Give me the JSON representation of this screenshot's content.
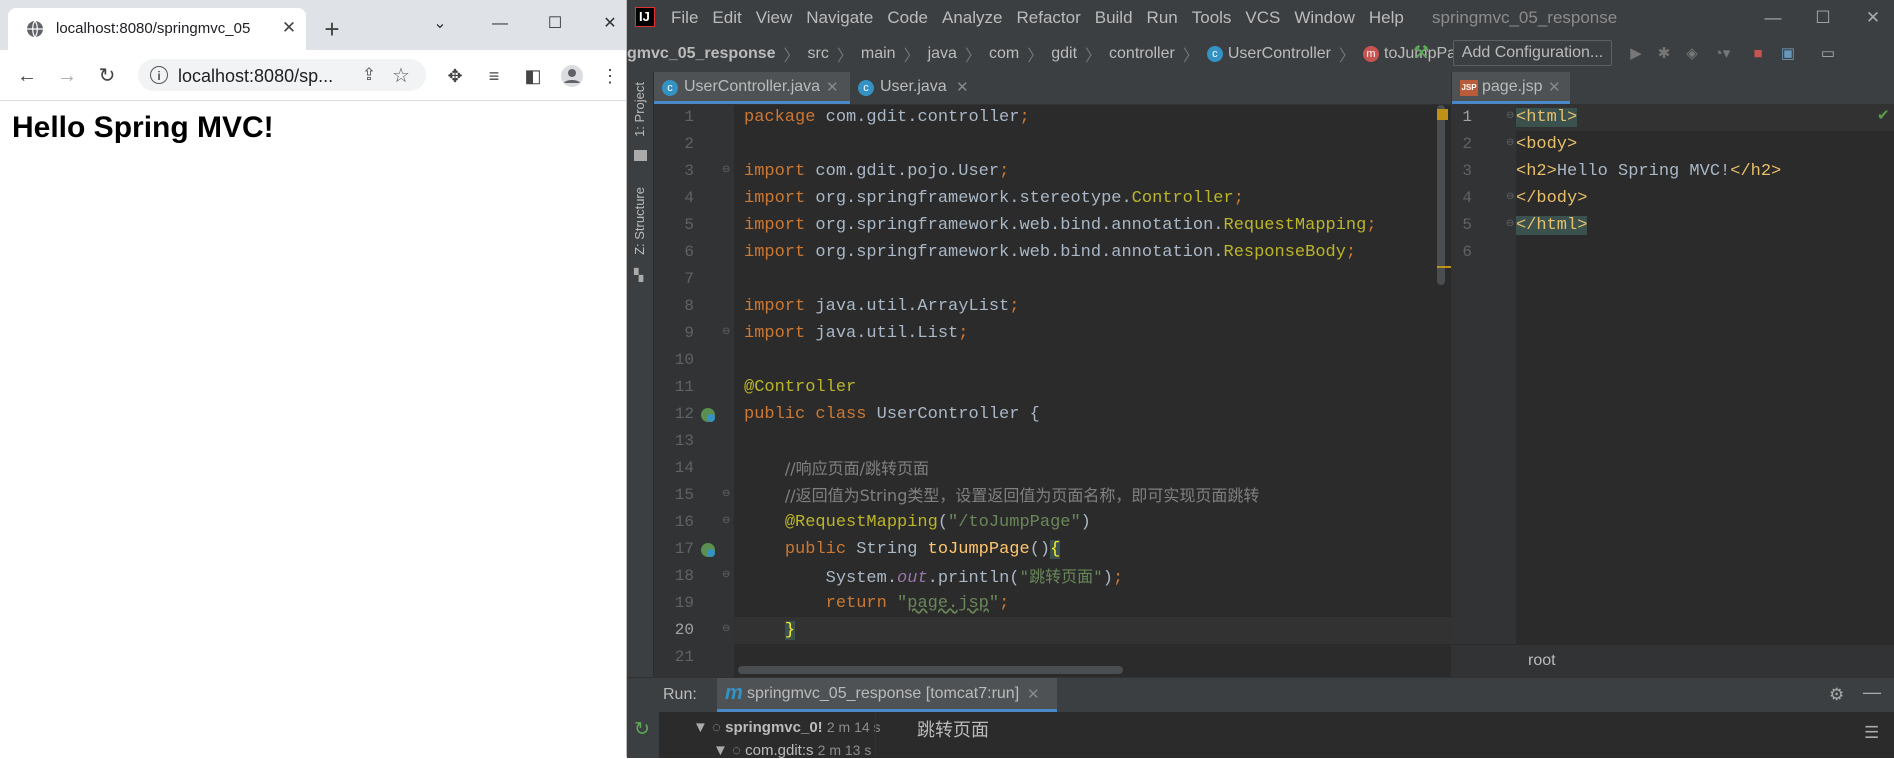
{
  "browser": {
    "tab_title": "localhost:8080/springmvc_05",
    "tab_close": "✕",
    "new_tab": "+",
    "url": "localhost:8080/sp...",
    "page_heading": "Hello Spring MVC!"
  },
  "ide": {
    "menu": [
      "File",
      "Edit",
      "View",
      "Navigate",
      "Code",
      "Analyze",
      "Refactor",
      "Build",
      "Run",
      "Tools",
      "VCS",
      "Window",
      "Help"
    ],
    "window_title": "springmvc_05_response",
    "breadcrumbs": [
      "gmvc_05_response",
      "src",
      "main",
      "java",
      "com",
      "gdit",
      "controller",
      "UserController",
      "toJumpPage"
    ],
    "add_configuration": "Add Configuration...",
    "sidebar": {
      "project": "1: Project",
      "structure": "Z: Structure"
    },
    "left_tabs": [
      {
        "label": "UserController.java",
        "close": "✕"
      },
      {
        "label": "User.java",
        "close": "✕"
      }
    ],
    "left_line_numbers": [
      "1",
      "2",
      "3",
      "4",
      "5",
      "6",
      "7",
      "8",
      "9",
      "10",
      "11",
      "12",
      "13",
      "14",
      "15",
      "16",
      "17",
      "18",
      "19",
      "20",
      "21"
    ],
    "code": {
      "l1": {
        "kw": "package",
        "rest": " com.gdit.controller",
        "semi": ";"
      },
      "l3": {
        "kw": "import",
        "rest": " com.gdit.pojo.User",
        "semi": ";"
      },
      "l4": {
        "kw": "import",
        "rest": " org.springframework.stereotype.",
        "cls": "Controller",
        "semi": ";"
      },
      "l5": {
        "kw": "import",
        "rest": " org.springframework.web.bind.annotation.",
        "cls": "RequestMapping",
        "semi": ";"
      },
      "l6": {
        "kw": "import",
        "rest": " org.springframework.web.bind.annotation.",
        "cls": "ResponseBody",
        "semi": ";"
      },
      "l8": {
        "kw": "import",
        "rest": " java.util.ArrayList",
        "semi": ";"
      },
      "l9": {
        "kw": "import",
        "rest": " java.util.List",
        "semi": ";"
      },
      "l11": {
        "ann": "@Controller"
      },
      "l12": {
        "kw": "public class",
        "rest": " UserController {"
      },
      "l14": {
        "cmt": "//响应页面/跳转页面"
      },
      "l15": {
        "cmt": "//返回值为String类型，设置返回值为页面名称，即可实现页面跳转"
      },
      "l16": {
        "ann": "@RequestMapping",
        "open": "(",
        "str": "\"/toJumpPage\"",
        "close": ")"
      },
      "l17": {
        "kw": "public",
        "rest": " String ",
        "fn": "toJumpPage",
        "paren": "()",
        "brace": "{"
      },
      "l18": {
        "pre": "System.",
        "out": "out",
        "mid": ".println(",
        "str": "\"跳转页面\"",
        "end": ")",
        "semi": ";"
      },
      "l19": {
        "kw": "return",
        "sp": " ",
        "q1": "\"",
        "str": "page.jsp",
        "q2": "\"",
        "semi": ";"
      },
      "l20": {
        "brace": "}"
      }
    },
    "right_tab": {
      "label": "page.jsp",
      "close": "✕",
      "icon_text": "JSP"
    },
    "right_line_numbers": [
      "1",
      "2",
      "3",
      "4",
      "5",
      "6"
    ],
    "jsp": {
      "l1": "<html>",
      "l2": "<body>",
      "l3_open": "<h2>",
      "l3_text": "Hello Spring MVC!",
      "l3_close": "</h2>",
      "l4": "</body>",
      "l5": "</html>"
    },
    "root_label": "root",
    "run": {
      "label": "Run:",
      "config": "springmvc_05_response [tomcat7:run]",
      "close": "✕",
      "tree": [
        {
          "name": "springmvc_0!",
          "time": "2 m 14 s"
        },
        {
          "name": "com.gdit:s",
          "time": "2 m 13 s"
        }
      ],
      "console_output": "跳转页面"
    }
  }
}
